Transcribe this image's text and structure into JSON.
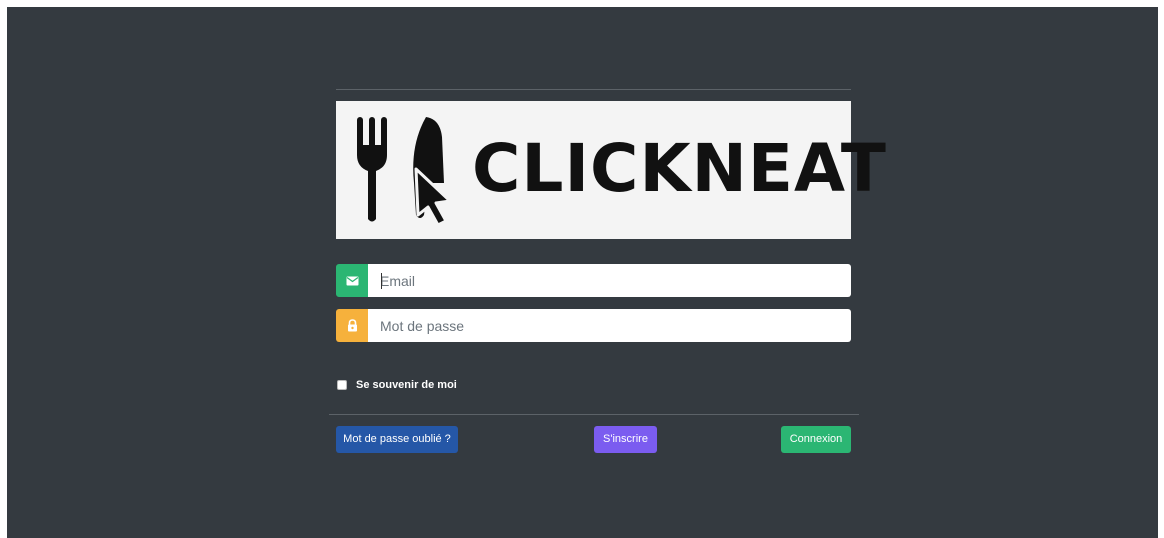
{
  "brand": {
    "logo_text": "CLICKNEAT",
    "logo_icon": "fork-knife-cursor-icon"
  },
  "form": {
    "email": {
      "placeholder": "Email",
      "value": "",
      "icon": "envelope-icon",
      "icon_color": "#2bb673"
    },
    "password": {
      "placeholder": "Mot de passe",
      "value": "",
      "icon": "lock-icon",
      "icon_color": "#f6b13c"
    },
    "remember_label": "Se souvenir de moi",
    "remember_checked": false
  },
  "actions": {
    "forgot_label": "Mot de passe oublié ?",
    "signup_label": "S'inscrire",
    "login_label": "Connexion"
  },
  "colors": {
    "background": "#343a40",
    "forgot": "#2557a7",
    "signup": "#7b5cf0",
    "login": "#2bb673"
  }
}
